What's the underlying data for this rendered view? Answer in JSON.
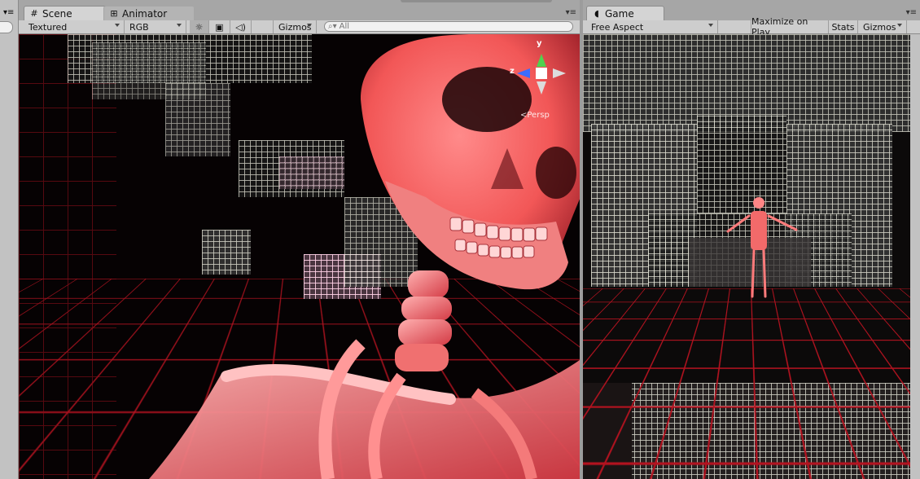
{
  "scene_panel": {
    "tabs": [
      {
        "label": "Scene",
        "icon": "scene-hash-icon"
      },
      {
        "label": "Animator",
        "icon": "animator-icon"
      }
    ],
    "toolbar": {
      "render_mode": "Textured",
      "color_mode": "RGB",
      "gizmos_label": "Gizmos",
      "search_placeholder": "All"
    },
    "gizmo": {
      "y_label": "y",
      "z_label": "z",
      "persp_label": "<Persp"
    }
  },
  "game_panel": {
    "tab": {
      "label": "Game",
      "icon": "game-pacman-icon"
    },
    "toolbar": {
      "aspect": "Free Aspect",
      "maximize_label": "Maximize on Play",
      "stats_label": "Stats",
      "gizmos_label": "Gizmos"
    }
  },
  "colors": {
    "skeleton": "#ff6b6b",
    "grid": "#b3121f",
    "panel_bg": "#c2c2c2"
  }
}
